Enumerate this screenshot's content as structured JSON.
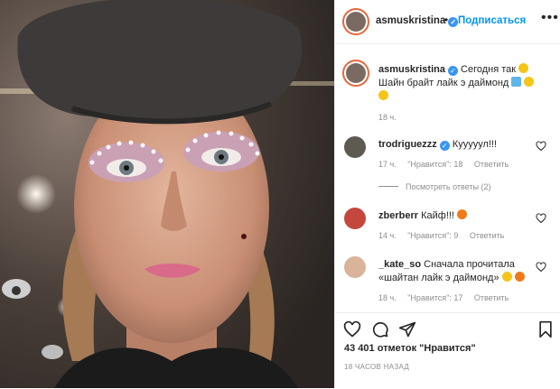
{
  "post": {
    "author": "asmuskristina",
    "follow_label": "Подписаться",
    "dot": "•",
    "more": "•••"
  },
  "caption": {
    "author": "asmuskristina",
    "line1": "Сегодня так",
    "line2": "Шайн брайт лайк э даймонд",
    "time": "18 ч."
  },
  "comments": [
    {
      "author": "trodriguezzz",
      "text": "Кууууул!!!",
      "time": "17 ч.",
      "likes": "\"Нравится\": 18",
      "reply": "Ответить"
    },
    {
      "author": "zberberr",
      "text": "Кайф!!!",
      "time": "14 ч.",
      "likes": "\"Нравится\": 9",
      "reply": "Ответить"
    },
    {
      "author": "_kate_so",
      "text_line1": "Сначала прочитала",
      "text_line2": "«шайтан лайк э даймонд»",
      "time": "18 ч.",
      "likes": "\"Нравится\": 17",
      "reply": "Ответить"
    }
  ],
  "view_replies": "Посмотреть ответы (2)",
  "likes_count": "43 401 отметок \"Нравится\"",
  "posted_time": "18 ЧАСОВ НАЗАД",
  "colors": {
    "blue": "#0095f6",
    "muted": "#8e8e8e",
    "ring": "#e6683c"
  },
  "icons": [
    "heart-icon",
    "comment-icon",
    "share-icon",
    "bookmark-icon",
    "verified-icon",
    "more-icon"
  ]
}
